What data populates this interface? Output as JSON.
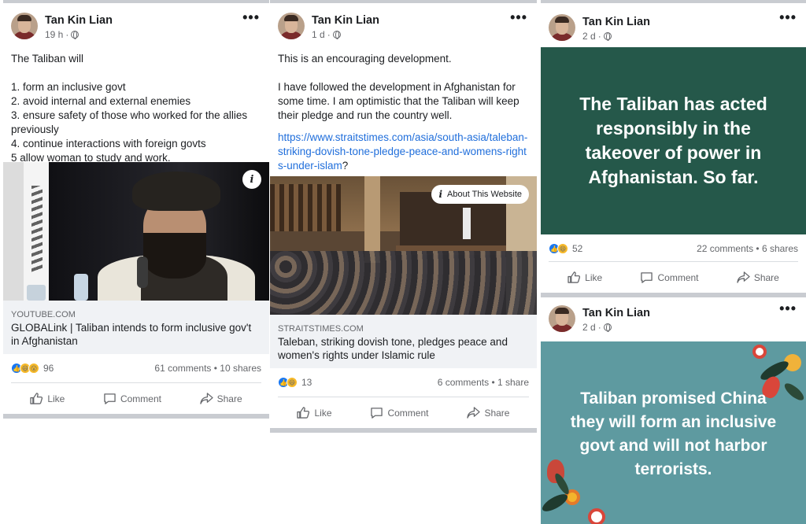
{
  "posts": [
    {
      "author": "Tan Kin Lian",
      "time": "19 h",
      "more": "•••",
      "text_lines": [
        "The Taliban will",
        "",
        "1. form an inclusive govt",
        "2. avoid internal and external enemies",
        "3. ensure safety of those who worked for the allies previously",
        "4. continue interactions with foreign govts",
        "5 allow woman to study and work."
      ],
      "link_domain": "YOUTUBE.COM",
      "link_title": "GLOBALink | Taliban intends to form inclusive gov't in Afghanistan",
      "info_icon": "i",
      "reaction_count": "96",
      "comments_shares": "61 comments • 10 shares",
      "like_label": "Like",
      "comment_label": "Comment",
      "share_label": "Share"
    },
    {
      "author": "Tan Kin Lian",
      "time": "1 d",
      "more": "•••",
      "text_lines": [
        "This is an encouraging development.",
        "",
        "I have followed the development in Afghanistan for some time. I am optimistic that the Taliban will keep their pledge and run the  country well."
      ],
      "url_text": "https://www.straitstimes.com/asia/south-asia/taleban-striking-dovish-tone-pledge-peace-and-womens-rights-under-islam",
      "url_suffix": "?",
      "about_label": "About This Website",
      "link_domain": "STRAITSTIMES.COM",
      "link_title": "Taleban, striking dovish tone, pledges peace and women's rights under Islamic rule",
      "reaction_count": "13",
      "comments_shares": "6 comments • 1 share",
      "like_label": "Like",
      "comment_label": "Comment",
      "share_label": "Share"
    },
    {
      "author": "Tan Kin Lian",
      "time": "2 d",
      "more": "•••",
      "card_text": "The Taliban has acted responsibly in the takeover of power in Afghanistan. So far.",
      "card_color": "#25584a",
      "reaction_count": "52",
      "comments_shares": "22 comments • 6 shares",
      "like_label": "Like",
      "comment_label": "Comment",
      "share_label": "Share"
    },
    {
      "author": "Tan Kin Lian",
      "time": "2 d",
      "more": "•••",
      "card_text": "Taliban promised China they will form an inclusive govt and will not harbor terrorists.",
      "card_color": "#5e9aa0"
    }
  ],
  "colors": {
    "link": "#216fdb",
    "like_blue": "#1877f2",
    "muted": "#65676b",
    "divider": "#c9ccd1"
  }
}
